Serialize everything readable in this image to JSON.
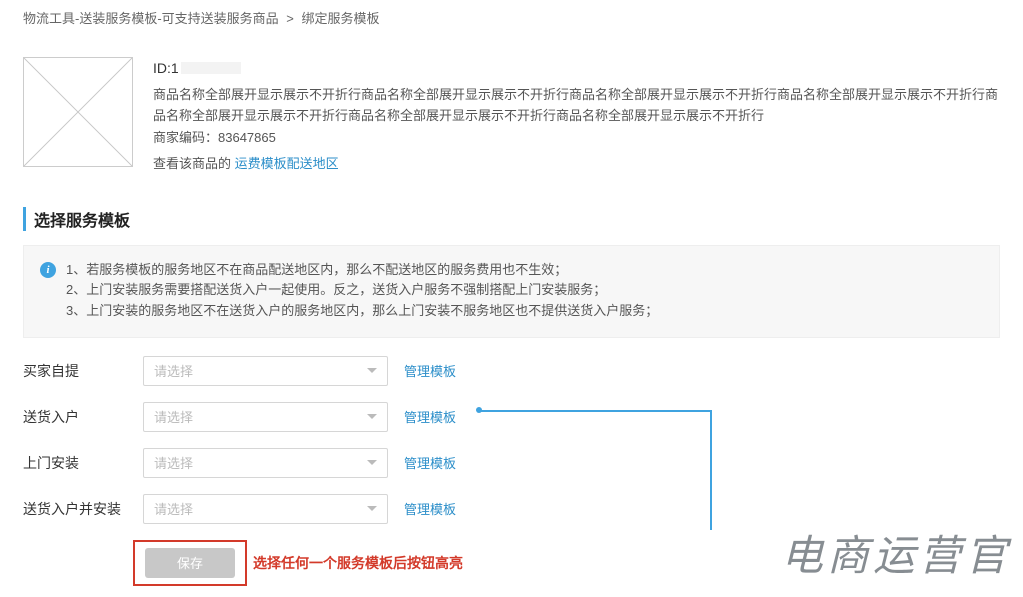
{
  "breadcrumb": {
    "part1": "物流工具-送装服务模板-可支持送装服务商品",
    "sep": ">",
    "part2": "绑定服务模板"
  },
  "product": {
    "id_label": "ID:1",
    "name": "商品名称全部展开显示展示不开折行商品名称全部展开显示展示不开折行商品名称全部展开显示展示不开折行商品名称全部展开显示展示不开折行商品名称全部展开显示展示不开折行商品名称全部展开显示展示不开折行商品名称全部展开显示展示不开折行",
    "code": "商家编码：83647865",
    "link_prefix": "查看该商品的",
    "link_text": "运费模板配送地区"
  },
  "section_title": "选择服务模板",
  "info": {
    "line1": "1、若服务模板的服务地区不在商品配送地区内，那么不配送地区的服务费用也不生效；",
    "line2": "2、上门安装服务需要搭配送货入户一起使用。反之，送货入户服务不强制搭配上门安装服务；",
    "line3": "3、上门安装的服务地区不在送货入户的服务地区内，那么上门安装不服务地区也不提供送货入户服务；"
  },
  "form": {
    "placeholder": "请选择",
    "manage_label": "管理模板",
    "rows": [
      {
        "label": "买家自提"
      },
      {
        "label": "送货入户"
      },
      {
        "label": "上门安装"
      },
      {
        "label": "送货入户并安装"
      }
    ]
  },
  "save": {
    "button": "保存",
    "hint": "选择任何一个服务模板后按钮高亮"
  },
  "watermark": "电商运营官"
}
